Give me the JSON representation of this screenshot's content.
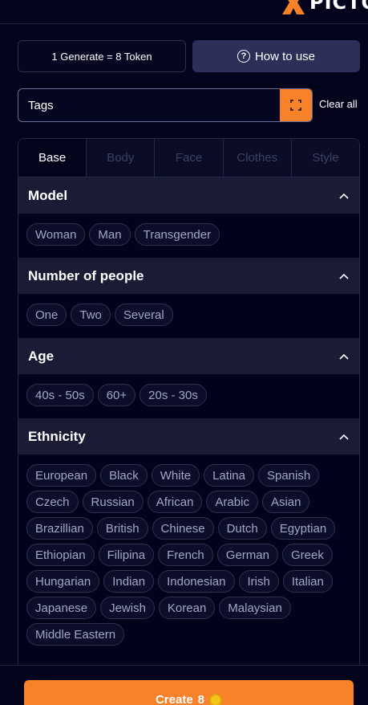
{
  "header": {
    "logo_text": "PICTO"
  },
  "token_info": "1 Generate = 8 Token",
  "how_to_use": "How to use",
  "tags": {
    "placeholder": "Tags",
    "clear_all": "Clear all"
  },
  "tabs": [
    {
      "label": "Base",
      "active": true
    },
    {
      "label": "Body",
      "active": false
    },
    {
      "label": "Face",
      "active": false
    },
    {
      "label": "Clothes",
      "active": false
    },
    {
      "label": "Style",
      "active": false
    }
  ],
  "sections": [
    {
      "title": "Model",
      "chips": [
        "Woman",
        "Man",
        "Transgender"
      ]
    },
    {
      "title": "Number of people",
      "chips": [
        "One",
        "Two",
        "Several"
      ]
    },
    {
      "title": "Age",
      "chips": [
        "40s - 50s",
        "60+",
        "20s - 30s"
      ]
    },
    {
      "title": "Ethnicity",
      "chips": [
        "European",
        "Black",
        "White",
        "Latina",
        "Spanish",
        "Czech",
        "Russian",
        "African",
        "Arabic",
        "Asian",
        "Brazillian",
        "British",
        "Chinese",
        "Dutch",
        "Egyptian",
        "Ethiopian",
        "Filipina",
        "French",
        "German",
        "Greek",
        "Hungarian",
        "Indian",
        "Indonesian",
        "Irish",
        "Italian",
        "Japanese",
        "Jewish",
        "Korean",
        "Malaysian",
        "Middle Eastern"
      ]
    }
  ],
  "create": {
    "label": "Create",
    "cost": "8"
  },
  "colors": {
    "accent": "#f7822a",
    "background": "#03041c",
    "section_header": "#1a1c36",
    "chip_border": "#2d3051"
  },
  "icons": {
    "logo": "x-logo-icon",
    "help": "question-circle-icon",
    "scan": "scan-frame-icon",
    "collapse": "chevron-up-icon",
    "token": "coin-icon"
  }
}
